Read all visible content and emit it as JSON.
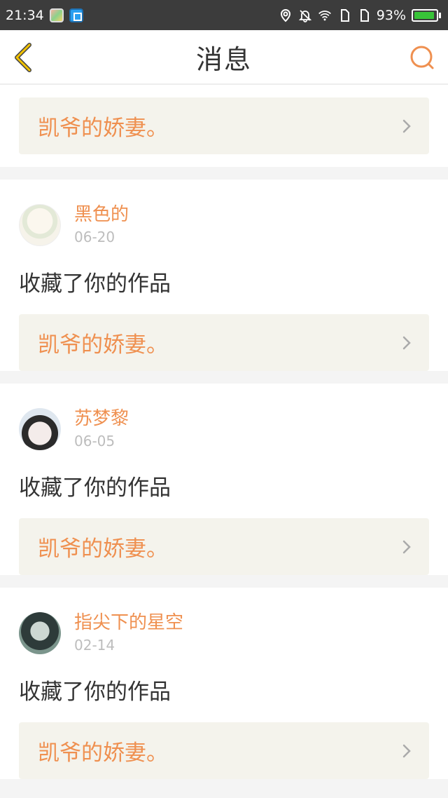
{
  "status_bar": {
    "time": "21:34",
    "battery": "93%"
  },
  "header": {
    "title": "消息"
  },
  "first_work": {
    "title": "凯爷的娇妻。"
  },
  "messages": [
    {
      "user": "黑色的",
      "date": "06-20",
      "action": "收藏了你的作品",
      "work": "凯爷的娇妻。"
    },
    {
      "user": "苏梦黎",
      "date": "06-05",
      "action": "收藏了你的作品",
      "work": "凯爷的娇妻。"
    },
    {
      "user": "指尖下的星空",
      "date": "02-14",
      "action": "收藏了你的作品",
      "work": "凯爷的娇妻。"
    }
  ],
  "colors": {
    "accent": "#ef9050",
    "back_icon": "#f2c200",
    "status_bar": "#3c3c3c"
  },
  "icons": [
    "back-chevron-icon",
    "search-icon",
    "chevron-right-icon",
    "location-icon",
    "bell-off-icon",
    "wifi-icon",
    "sim-icon",
    "battery-icon"
  ]
}
